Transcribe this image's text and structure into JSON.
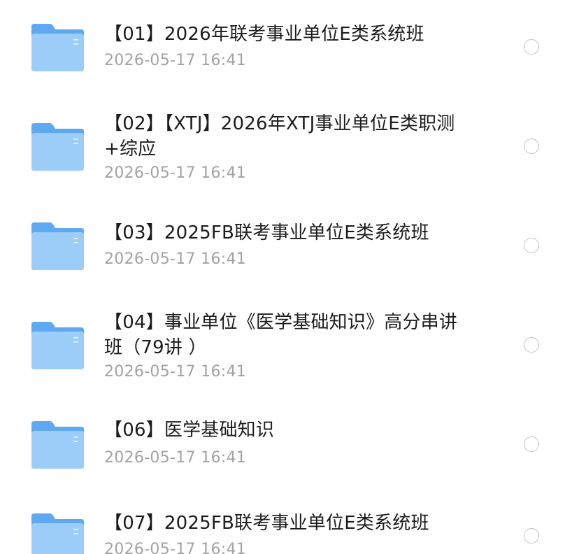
{
  "files": [
    {
      "name": "【01】2026年联考事业单位E类系统班",
      "date": "2026-05-17 16:41",
      "icon": "folder-icon"
    },
    {
      "name": "【02】【XTJ】2026年XTJ事业单位E类职测+综应",
      "date": "2026-05-17 16:41",
      "icon": "folder-icon"
    },
    {
      "name": "【03】2025FB联考事业单位E类系统班",
      "date": "2026-05-17 16:41",
      "icon": "folder-icon"
    },
    {
      "name": "【04】事业单位《医学基础知识》高分串讲班（79讲 ）",
      "date": "2026-05-17 16:41",
      "icon": "folder-icon"
    },
    {
      "name": "【06】医学基础知识",
      "date": "2026-05-17 16:41",
      "icon": "folder-icon"
    },
    {
      "name": "【07】2025FB联考事业单位E类系统班",
      "date": "2026-05-17 16:41",
      "icon": "folder-icon"
    }
  ],
  "colors": {
    "folder_back": "#5ea9f0",
    "folder_front": "#9ccdf9",
    "title_text": "#1c1c1c",
    "date_text": "#a3a3a3",
    "radio_border": "#c4c4c4"
  }
}
